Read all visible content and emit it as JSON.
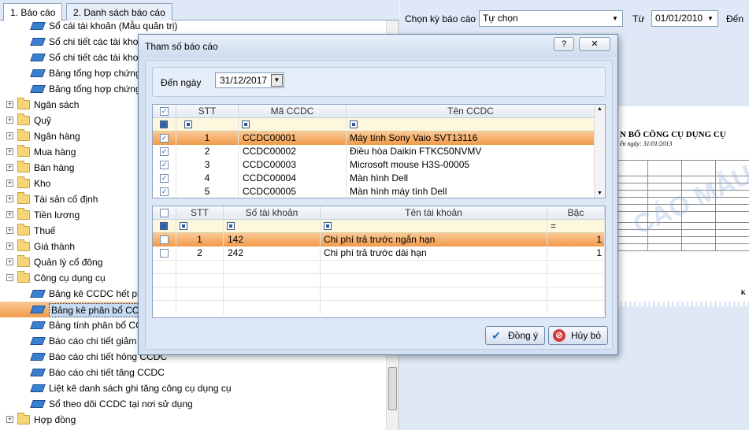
{
  "left_tabs": [
    "1. Báo cáo",
    "2. Danh sách báo cáo"
  ],
  "tree": [
    {
      "label": "Sổ cái tài khoản (Mẫu quản trị)",
      "level": 2
    },
    {
      "label": "Sổ chi tiết các tài khoả",
      "level": 2
    },
    {
      "label": "Sổ chi tiết các tài khoả",
      "level": 2
    },
    {
      "label": "Bảng tổng hợp chứng từ",
      "level": 2
    },
    {
      "label": "Bảng tổng hợp chứng từ",
      "level": 2
    },
    {
      "label": "Ngân sách",
      "level": 1
    },
    {
      "label": "Quỹ",
      "level": 1
    },
    {
      "label": "Ngân hàng",
      "level": 1
    },
    {
      "label": "Mua hàng",
      "level": 1
    },
    {
      "label": "Bán hàng",
      "level": 1
    },
    {
      "label": "Kho",
      "level": 1
    },
    {
      "label": "Tài sản cố định",
      "level": 1
    },
    {
      "label": "Tiền lương",
      "level": 1
    },
    {
      "label": "Thuế",
      "level": 1
    },
    {
      "label": "Giá thành",
      "level": 1
    },
    {
      "label": "Quản lý cổ đông",
      "level": 1
    },
    {
      "label": "Công cụ dụng cụ",
      "level": 1,
      "expanded": true
    },
    {
      "label": "Bảng kê CCDC hết phân",
      "level": 2
    },
    {
      "label": "Bảng kê phân bổ CCDC",
      "level": 2,
      "selected": true
    },
    {
      "label": "Bảng tính phân bổ CCD",
      "level": 2
    },
    {
      "label": "Báo cáo chi tiết giảm C",
      "level": 2
    },
    {
      "label": "Báo cáo chi tiết hỏng CCDC",
      "level": 2
    },
    {
      "label": "Báo cáo chi tiết tăng CCDC",
      "level": 2
    },
    {
      "label": "Liệt kê danh sách ghi tăng công cụ dụng cụ",
      "level": 2
    },
    {
      "label": "Sổ theo dõi CCDC tại nơi sử dụng",
      "level": 2
    },
    {
      "label": "Hợp đồng",
      "level": 1
    }
  ],
  "right_header": {
    "period_label": "Chọn kỳ báo cáo",
    "period_value": "Tự chọn",
    "from_label": "Từ",
    "from_value": "01/01/2010",
    "to_label": "Đến"
  },
  "preview": {
    "title": "N BỔ CÔNG CỤ DỤNG CỤ",
    "subtitle": "ến ngày: 31/01/2013",
    "watermark": "CÁO MẪU",
    "footer": "K"
  },
  "dialog": {
    "title": "Tham số báo cáo",
    "help_icon": "?",
    "date_label": "Đến ngày",
    "date_value": "31/12/2017",
    "tools": {
      "columns": [
        "STT",
        "Mã CCDC",
        "Tên CCDC"
      ],
      "rows": [
        {
          "stt": "1",
          "code": "CCDC00001",
          "name": "Máy tính Sony Vaio SVT13116",
          "checked": true,
          "selected": true
        },
        {
          "stt": "2",
          "code": "CCDC00002",
          "name": "Điều hòa Daikin FTKC50NVMV",
          "checked": true
        },
        {
          "stt": "3",
          "code": "CCDC00003",
          "name": "Microsoft mouse H3S-00005",
          "checked": true
        },
        {
          "stt": "4",
          "code": "CCDC00004",
          "name": "Màn hình Dell",
          "checked": true
        },
        {
          "stt": "5",
          "code": "CCDC00005",
          "name": "Màn hình máy tính Dell",
          "checked": true
        }
      ]
    },
    "accounts": {
      "columns": [
        "STT",
        "Số tài khoản",
        "Tên tài khoản",
        "Bậc"
      ],
      "level_filter": "=",
      "rows": [
        {
          "stt": "1",
          "account": "142",
          "name": "Chi phí trả trước ngắn hạn",
          "level": "1",
          "checked": false,
          "selected": true
        },
        {
          "stt": "2",
          "account": "242",
          "name": "Chi phí trả trước dài hạn",
          "level": "1",
          "checked": false
        }
      ]
    },
    "ok_label": "Đồng ý",
    "cancel_label": "Hủy bỏ"
  }
}
